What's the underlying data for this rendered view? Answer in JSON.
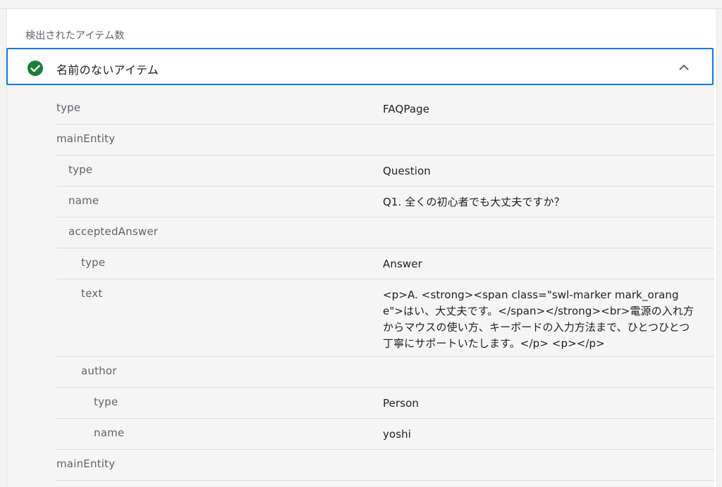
{
  "section_label": "検出されたアイテム数",
  "item": {
    "title": "名前のないアイテム",
    "status_icon": "check-circle-icon",
    "toggle_icon": "chevron-up-icon",
    "accent_color": "#1a73e8",
    "status_color": "#188038"
  },
  "rows": [
    {
      "key": "type",
      "value": "FAQPage",
      "level": 0
    },
    {
      "key": "mainEntity",
      "value": "",
      "level": 0
    },
    {
      "key": "type",
      "value": "Question",
      "level": 1
    },
    {
      "key": "name",
      "value": "Q1. 全くの初心者でも大丈夫ですか？",
      "level": 1
    },
    {
      "key": "acceptedAnswer",
      "value": "",
      "level": 1
    },
    {
      "key": "type",
      "value": "Answer",
      "level": 2
    },
    {
      "key": "text",
      "value": "<p>A. <strong><span class=\"swl-marker mark_orange\">はい、大丈夫です。</span></strong><br>電源の入れ方からマウスの使い方、キーボードの入力方法まで、ひとつひとつ丁寧にサポートいたします。</p> <p></p>",
      "level": 2
    },
    {
      "key": "author",
      "value": "",
      "level": 2
    },
    {
      "key": "type",
      "value": "Person",
      "level": 3
    },
    {
      "key": "name",
      "value": "yoshi",
      "level": 3
    },
    {
      "key": "mainEntity",
      "value": "",
      "level": 0
    }
  ]
}
